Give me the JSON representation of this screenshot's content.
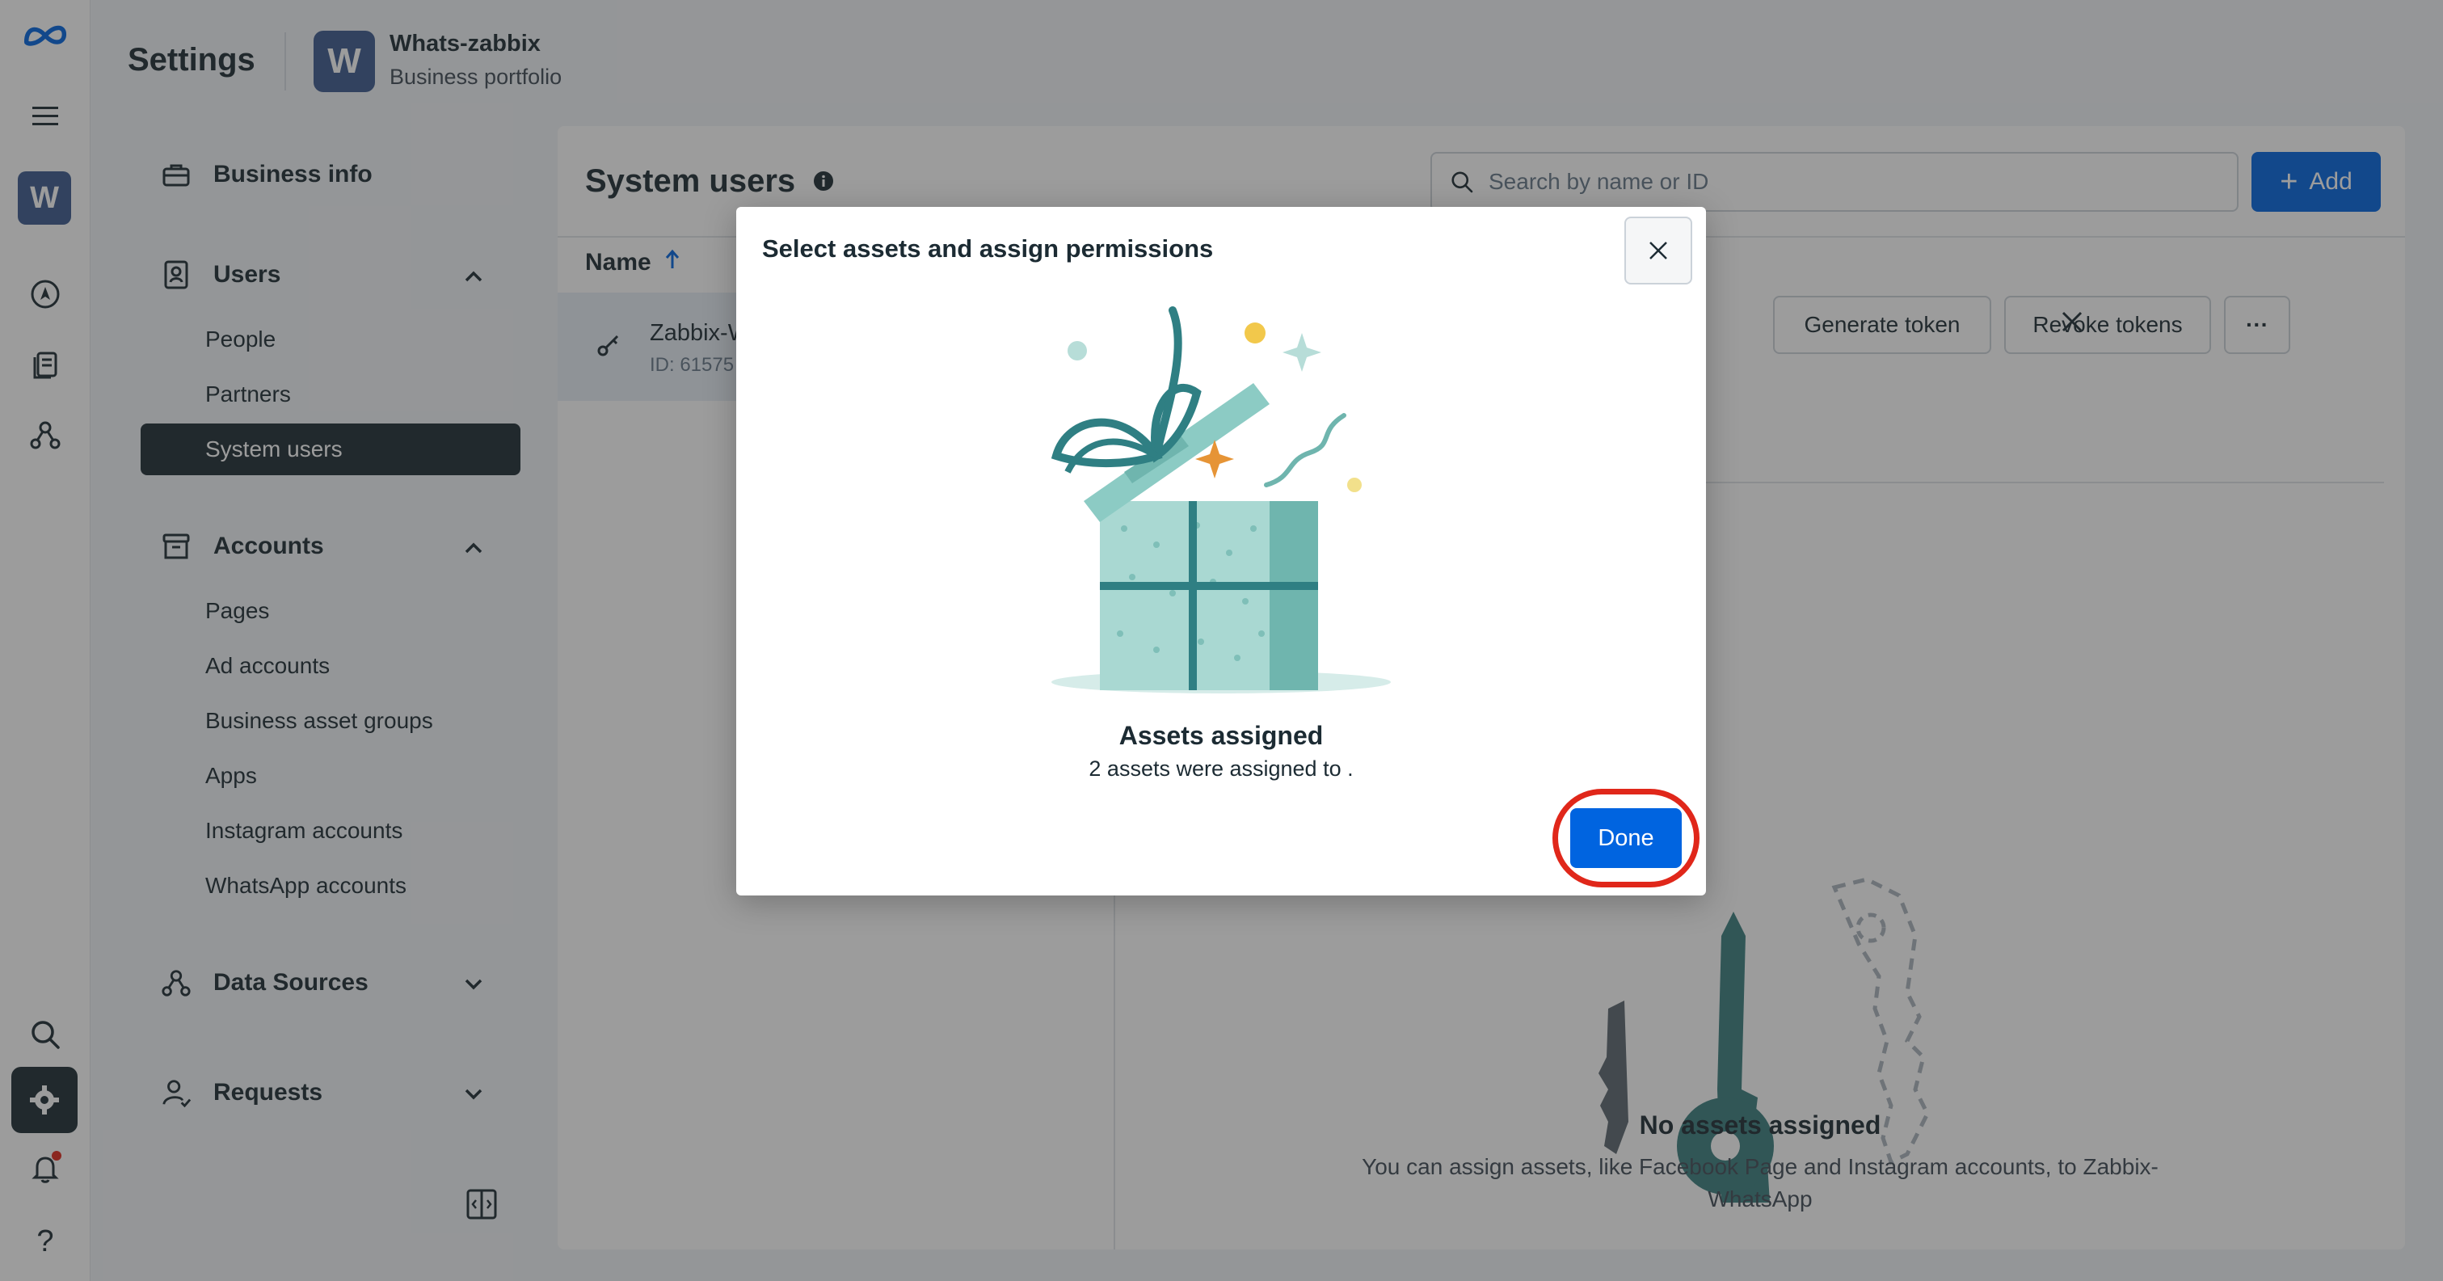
{
  "header": {
    "title": "Settings",
    "portfolio_initial": "W",
    "portfolio_name": "Whats-zabbix",
    "portfolio_sub": "Business portfolio"
  },
  "rail": {
    "workspace_initial": "W",
    "icons": [
      "meta-logo-icon",
      "menu-icon",
      "workspace-avatar",
      "compass-icon",
      "documents-icon",
      "network-icon",
      "search-icon",
      "gear-icon",
      "bell-icon",
      "help-icon"
    ],
    "help_glyph": "?"
  },
  "sidebar": {
    "business_info": "Business info",
    "users": {
      "label": "Users",
      "items": [
        "People",
        "Partners",
        "System users"
      ]
    },
    "accounts": {
      "label": "Accounts",
      "items": [
        "Pages",
        "Ad accounts",
        "Business asset groups",
        "Apps",
        "Instagram accounts",
        "WhatsApp accounts"
      ]
    },
    "data_sources": "Data Sources",
    "requests": "Requests"
  },
  "main": {
    "title": "System users",
    "search_placeholder": "Search by name or ID",
    "add_label": "Add",
    "col_name": "Name",
    "row": {
      "name": "Zabbix-WhatsApp",
      "id": "ID: 61575"
    },
    "generate_token": "Generate token",
    "revoke_tokens": "Revoke tokens",
    "more_label": "···",
    "empty_title": "No assets assigned",
    "empty_desc": "You can assign assets, like Facebook Page and Instagram accounts, to Zabbix-WhatsApp"
  },
  "modal": {
    "title": "Select assets and assign permissions",
    "success_title": "Assets assigned",
    "success_desc": "2 assets were assigned to .",
    "done_label": "Done"
  },
  "colors": {
    "primary": "#0064e0",
    "dark": "#1c2b33",
    "highlight_ring": "#e0271a",
    "gift_teal": "#2f7f83",
    "gift_light": "#a9d8d2"
  }
}
